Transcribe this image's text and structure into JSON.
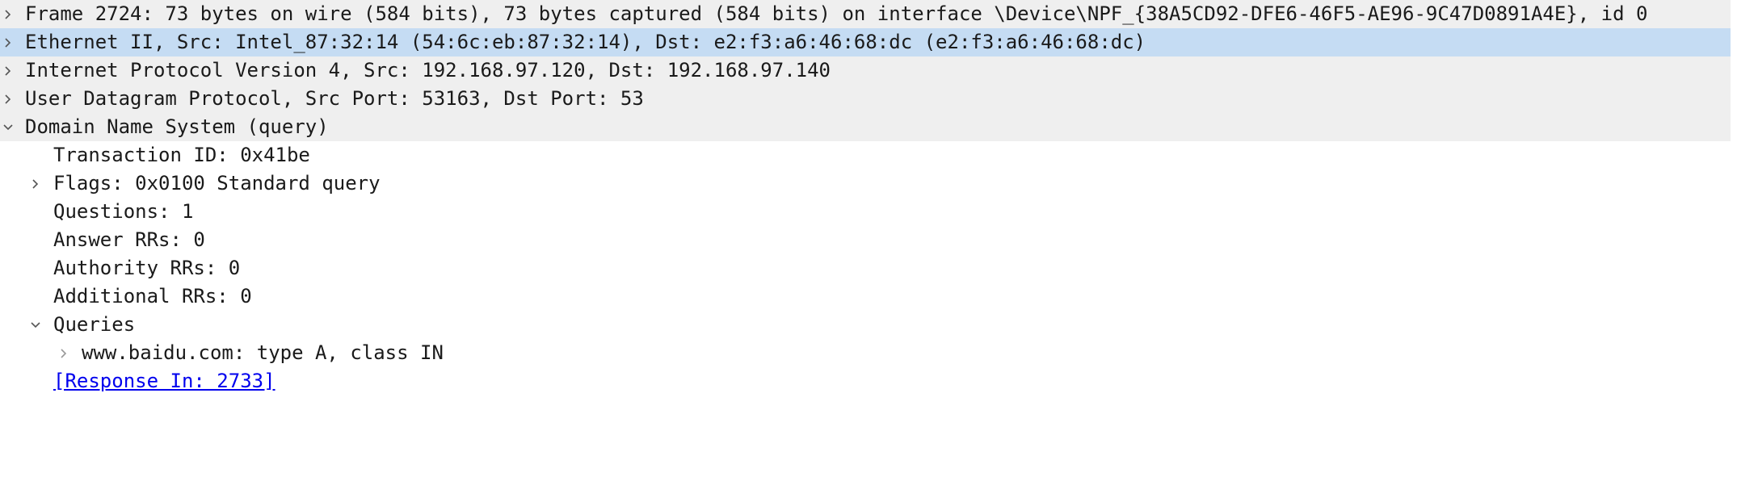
{
  "tree": {
    "rows": [
      {
        "text": "Frame 2724: 73 bytes on wire (584 bits), 73 bytes captured (584 bits) on interface \\Device\\NPF_{38A5CD92-DFE6-46F5-AE96-9C47D0891A4E}, id 0",
        "expander": "chevron-right-icon",
        "selected": false
      },
      {
        "text": "Ethernet II, Src: Intel_87:32:14 (54:6c:eb:87:32:14), Dst: e2:f3:a6:46:68:dc (e2:f3:a6:46:68:dc)",
        "expander": "chevron-right-icon",
        "selected": true
      },
      {
        "text": "Internet Protocol Version 4, Src: 192.168.97.120, Dst: 192.168.97.140",
        "expander": "chevron-right-icon",
        "selected": false
      },
      {
        "text": "User Datagram Protocol, Src Port: 53163, Dst Port: 53",
        "expander": "chevron-right-icon",
        "selected": false
      },
      {
        "text": "Domain Name System (query)",
        "expander": "chevron-down-icon",
        "selected": false
      },
      {
        "text": "Transaction ID: 0x41be"
      },
      {
        "text": "Flags: 0x0100 Standard query",
        "expander": "chevron-right-icon"
      },
      {
        "text": "Questions: 1"
      },
      {
        "text": "Answer RRs: 0"
      },
      {
        "text": "Authority RRs: 0"
      },
      {
        "text": "Additional RRs: 0"
      },
      {
        "text": "Queries",
        "expander": "chevron-down-icon"
      },
      {
        "text": "www.baidu.com: type A, class IN",
        "expander": "chevron-right-icon"
      },
      {
        "text": "[Response In: 2733]",
        "link": true
      }
    ]
  },
  "colors": {
    "top_level_background": "#efefef",
    "selected_background": "#c5dcf3",
    "link": "#0000ee",
    "text": "#1a1a1a",
    "chevron": "#555555"
  }
}
